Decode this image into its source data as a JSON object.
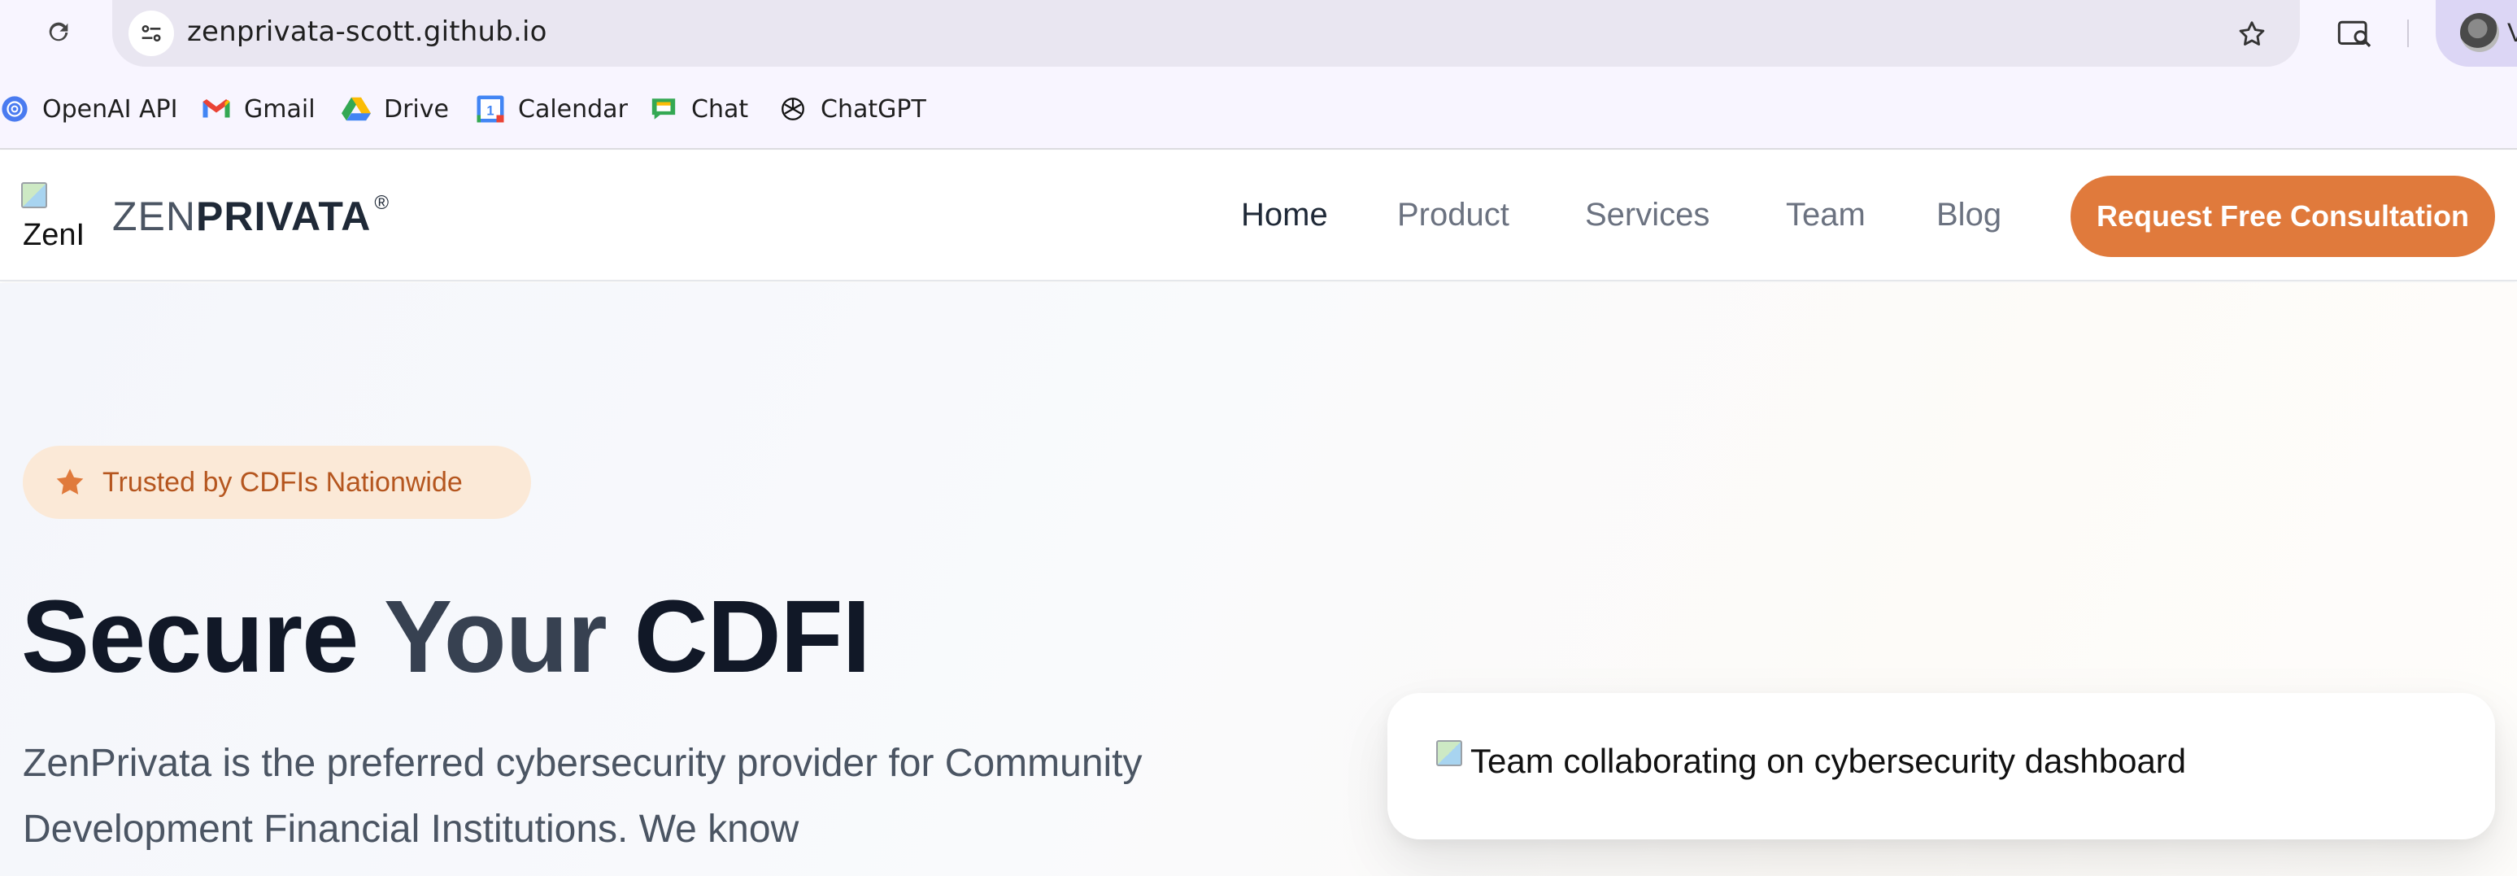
{
  "browser": {
    "url": "zenprivata-scott.github.io",
    "profile_letter": "V",
    "bookmarks": [
      {
        "label": "OpenAI API",
        "icon": "openai-api-icon"
      },
      {
        "label": "Gmail",
        "icon": "gmail-icon"
      },
      {
        "label": "Drive",
        "icon": "google-drive-icon"
      },
      {
        "label": "Calendar",
        "icon": "google-calendar-icon"
      },
      {
        "label": "Chat",
        "icon": "google-chat-icon"
      },
      {
        "label": "ChatGPT",
        "icon": "chatgpt-icon"
      }
    ]
  },
  "header": {
    "logo_alt": "ZenI",
    "logo_zen": "ZEN",
    "logo_privata": "PRIVATA",
    "logo_mark": "®",
    "nav": [
      {
        "label": "Home",
        "active": true
      },
      {
        "label": "Product",
        "active": false
      },
      {
        "label": "Services",
        "active": false
      },
      {
        "label": "Team",
        "active": false
      },
      {
        "label": "Blog",
        "active": false
      }
    ],
    "cta_label": "Request Free Consultation"
  },
  "hero": {
    "badge_text": "Trusted by CDFIs Nationwide",
    "title_part1": "Secure ",
    "title_part2": "Your ",
    "title_part3": "CDFI",
    "description": "ZenPrivata is the preferred cybersecurity provider for Community Development Financial Institutions. We know",
    "image_alt": "Team collaborating on cybersecurity dashboard"
  },
  "colors": {
    "accent": "#e07a3c",
    "badge_bg": "#fbe9d7",
    "badge_text": "#b5561f",
    "title": "#111827",
    "body_text": "#4b5563"
  }
}
